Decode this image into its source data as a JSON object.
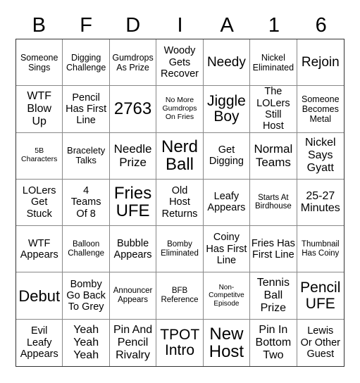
{
  "header": {
    "letters": [
      "B",
      "F",
      "D",
      "I",
      "A",
      "1",
      "6"
    ]
  },
  "board": {
    "rows": [
      [
        "Someone Sings",
        "Digging Challenge",
        "Gumdrops As Prize",
        "Woody Gets Recover",
        "Needy",
        "Nickel Eliminated",
        "Rejoin"
      ],
      [
        "WTF Blow Up",
        "Pencil Has First Line",
        "2763",
        "No More Gumdrops On Fries",
        "Jiggle Boy",
        "The LOLers Still Host",
        "Someone Becomes Metal"
      ],
      [
        "5B Characters",
        "Bracelety Talks",
        "Needle Prize",
        "Nerd Ball",
        "Get Digging",
        "Normal Teams",
        "Nickel Says Gyatt"
      ],
      [
        "LOLers Get Stuck",
        "4 Teams Of 8",
        "Fries UFE",
        "Old Host Returns",
        "Leafy Appears",
        "Starts At Birdhouse",
        "25-27 Minutes"
      ],
      [
        "WTF Appears",
        "Balloon Challenge",
        "Bubble Appears",
        "Bomby Eliminated",
        "Coiny Has First Line",
        "Fries Has First Line",
        "Thumbnail Has Coiny"
      ],
      [
        "Debut",
        "Bomby Go Back To Grey",
        "Announcer Appears",
        "BFB Reference",
        "Non-Competitve Episode",
        "Tennis Ball Prize",
        "Pencil UFE"
      ],
      [
        "Evil Leafy Appears",
        "Yeah Yeah Yeah",
        "Pin And Pencil Rivalry",
        "TPOT Intro",
        "New Host",
        "Pin In Bottom Two",
        "Lewis Or Other Guest"
      ]
    ]
  }
}
